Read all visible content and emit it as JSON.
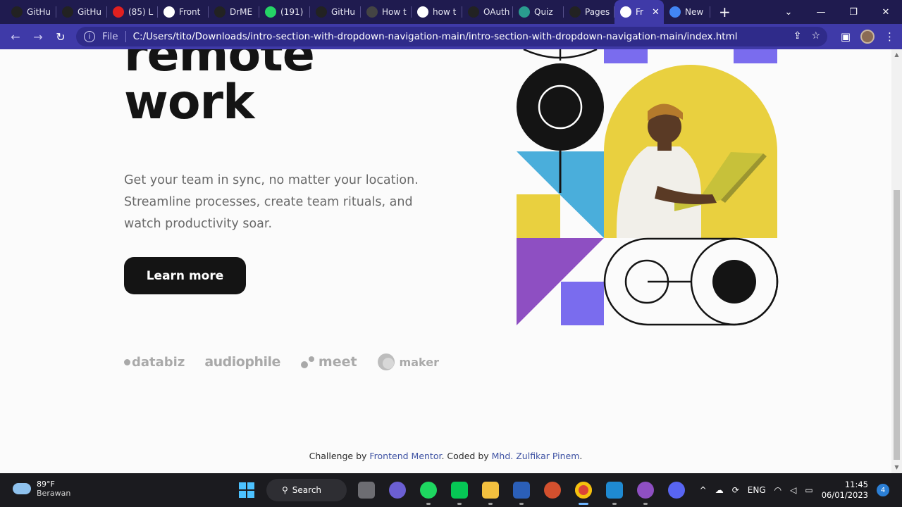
{
  "browser": {
    "tabs": [
      {
        "label": "GitHu",
        "icon": "github-icon",
        "color": "#222"
      },
      {
        "label": "GitHu",
        "icon": "github-icon",
        "color": "#222"
      },
      {
        "label": "(85) L",
        "icon": "youtube-icon",
        "color": "#e02020"
      },
      {
        "label": "Front",
        "icon": "frontend-mentor-icon",
        "color": "#ffffff"
      },
      {
        "label": "DrME",
        "icon": "github-icon",
        "color": "#222"
      },
      {
        "label": "(191)",
        "icon": "whatsapp-icon",
        "color": "#25d366"
      },
      {
        "label": "GitHu",
        "icon": "github-icon",
        "color": "#222"
      },
      {
        "label": "How t",
        "icon": "terminal-icon",
        "color": "#444"
      },
      {
        "label": "how t",
        "icon": "google-icon",
        "color": "#ffffff"
      },
      {
        "label": "OAuth",
        "icon": "github-icon",
        "color": "#222"
      },
      {
        "label": "Quiz",
        "icon": "quiz-icon",
        "color": "#2a9d8f"
      },
      {
        "label": "Pages",
        "icon": "github-icon",
        "color": "#222"
      },
      {
        "label": "Fr",
        "icon": "frontend-mentor-icon",
        "color": "#ffffff",
        "active": true
      },
      {
        "label": "New",
        "icon": "chrome-icon",
        "color": "#4285f4"
      }
    ],
    "file_label": "File",
    "url": "C:/Users/tito/Downloads/intro-section-with-dropdown-navigation-main/intro-section-with-dropdown-navigation-main/index.html"
  },
  "page": {
    "headline": [
      "remote",
      "work"
    ],
    "intro": "Get your team in sync, no matter your location. Streamline processes, create team rituals, and watch productivity soar.",
    "cta_label": "Learn more",
    "clients": {
      "databiz": "databiz",
      "audiophile_top": "audio",
      "audiophile_bottom": "phile",
      "meet": "meet",
      "maker": "maker"
    },
    "footer": {
      "prefix": "Challenge by ",
      "link1": "Frontend Mentor",
      "middle": ". Coded by ",
      "link2": "Mhd. Zulfikar Pinem",
      "suffix": "."
    }
  },
  "taskbar": {
    "temperature": "89°F",
    "condition": "Berawan",
    "search_label": "Search",
    "language": "ENG",
    "time": "11:45",
    "date": "06/01/2023",
    "notification_count": "4"
  },
  "colors": {
    "accent": "#3f3aa8",
    "dark": "#141414",
    "yellow": "#e9d03f",
    "blue": "#4aaedb",
    "purple": "#8e4fc2",
    "violet": "#7a6cee"
  }
}
